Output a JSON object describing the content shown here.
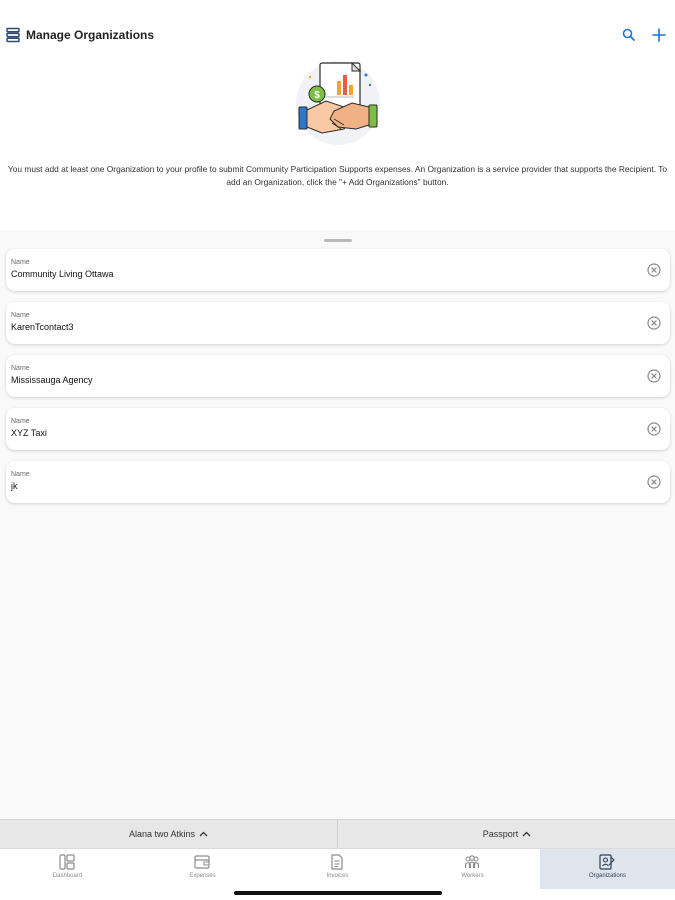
{
  "header": {
    "title": "Manage Organizations",
    "info_text": "You must add at least one Organization to your profile to submit Community Participation Supports expenses. An Organization is a service provider that supports the Recipient. To add an Organization, click the \"+ Add Organizations\" button.",
    "icons": {
      "title": "list-icon",
      "search": "search-icon",
      "add": "plus-icon",
      "illustration": "handshake-illustration"
    }
  },
  "organizations": [
    {
      "label": "Name",
      "value": "Community Living Ottawa"
    },
    {
      "label": "Name",
      "value": "KarenTcontact3"
    },
    {
      "label": "Name",
      "value": "Mississauga Agency"
    },
    {
      "label": "Name",
      "value": "XYZ Taxi"
    },
    {
      "label": "Name",
      "value": "jk"
    }
  ],
  "selectors": {
    "recipient": "Alana two Atkins",
    "passport": "Passport"
  },
  "tabs": [
    {
      "label": "Dashboard",
      "icon": "dashboard-icon",
      "active": false
    },
    {
      "label": "Expenses",
      "icon": "wallet-icon",
      "active": false
    },
    {
      "label": "Invoices",
      "icon": "invoice-icon",
      "active": false
    },
    {
      "label": "Workers",
      "icon": "workers-icon",
      "active": false
    },
    {
      "label": "Organizations",
      "icon": "organizations-icon",
      "active": true
    }
  ],
  "colors": {
    "accent": "#1a73e8",
    "active_tab_bg": "#dfe5ec",
    "clear_icon": "#8a8a8a"
  }
}
